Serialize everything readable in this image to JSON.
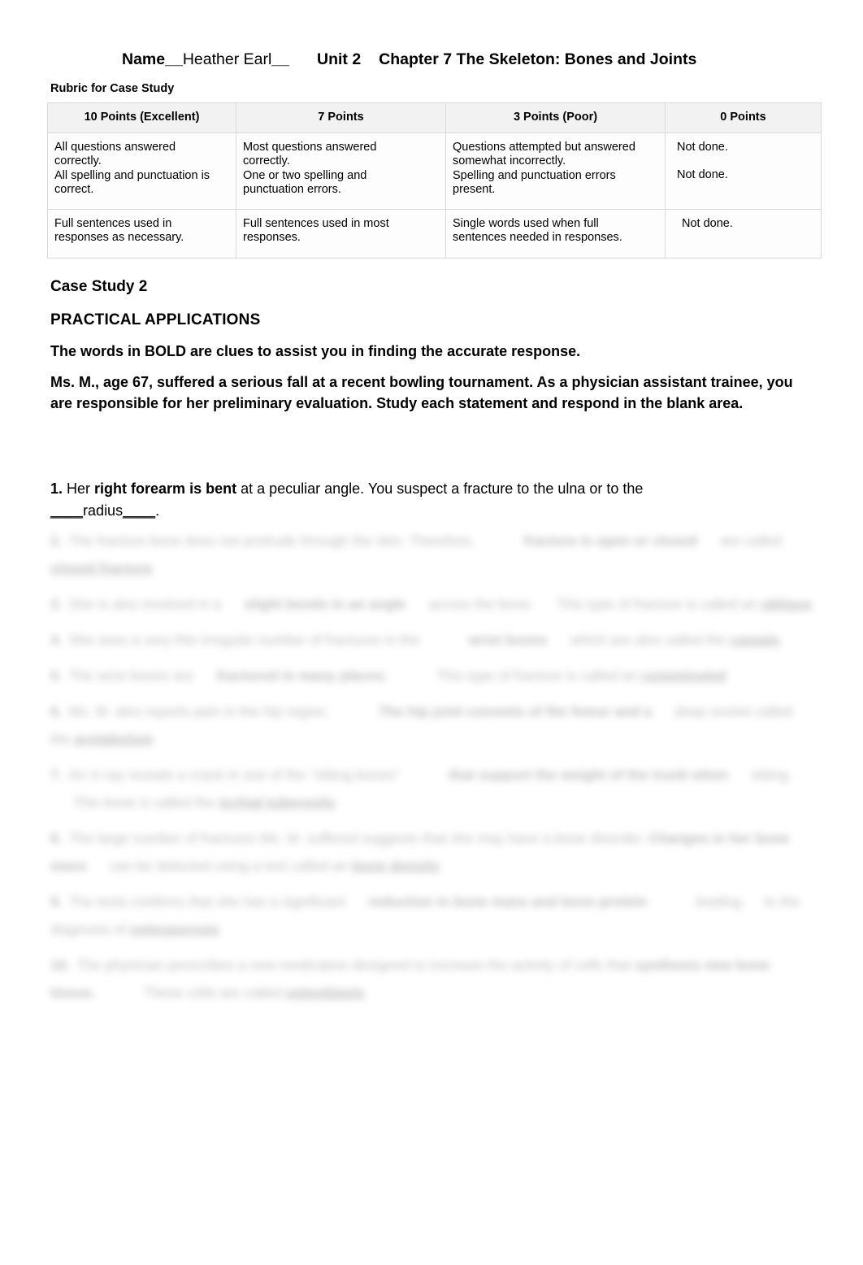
{
  "header": {
    "name_label": "Name",
    "name_underscore_left": "__",
    "name_value": "Heather Earl",
    "name_underscore_right": "__",
    "unit": "Unit 2",
    "chapter": "Chapter 7 The Skeleton: Bones and Joints"
  },
  "rubric": {
    "caption": "Rubric for Case Study",
    "columns": [
      "10 Points (Excellent)",
      "7 Points",
      "3 Points (Poor)",
      "0 Points"
    ],
    "rows": [
      {
        "cells": [
          {
            "lines": [
              "All questions answered",
              "correctly.",
              "All spelling and punctuation is",
              "correct."
            ]
          },
          {
            "lines": [
              "Most questions answered",
              "correctly.",
              "One or two spelling and",
              "punctuation errors."
            ]
          },
          {
            "lines": [
              "Questions attempted but answered",
              "somewhat incorrectly.",
              "Spelling and punctuation errors",
              "present."
            ]
          },
          {
            "lines": [
              "Not done.",
              "",
              "Not done.",
              ""
            ]
          }
        ]
      },
      {
        "cells": [
          {
            "lines": [
              "Full sentences used in",
              "responses as necessary."
            ]
          },
          {
            "lines": [
              "Full sentences used in most",
              "responses."
            ]
          },
          {
            "lines": [
              "Single words used when full",
              "sentences needed in responses."
            ]
          },
          {
            "lines": [
              "Not done."
            ]
          }
        ]
      }
    ]
  },
  "body": {
    "case_study_heading": "Case Study 2",
    "practical_applications_heading": "PRACTICAL APPLICATIONS",
    "bold_clue_note": "The words in BOLD are clues to assist you in finding the accurate response.",
    "scenario": "Ms. M., age 67, suffered a serious fall at a recent bowling tournament.  As a physician assistant trainee, you are responsible for her preliminary evaluation.  Study each statement and respond in the blank area."
  },
  "question_1": {
    "number": "1.",
    "text_before_clue": "Her ",
    "clue": "right forearm is bent",
    "text_after_clue": " at a peculiar angle.  You suspect a fracture to the ulna or to the",
    "blank_prefix": "____",
    "answer": "radius",
    "blank_suffix": "____",
    "trailing": "."
  },
  "redacted_questions": {
    "note": "Questions 2 through 10 are visually blurred and illegible in the source image.",
    "items": [
      {
        "number": "2.",
        "line1": "The fracture bone does not protrude through the skin. Therefore,",
        "line2": "fracture is open or closed",
        "line3": "are called",
        "answer": "closed fracture"
      },
      {
        "number": "3.",
        "line1": "She is also involved in a",
        "line2": "slight bends in an angle",
        "line3": "across the bone.",
        "line4": "This type of fracture is called an",
        "answer": "oblique"
      },
      {
        "number": "4.",
        "line1": "She sees a very thin irregular number of fractures in the",
        "line2": "wrist bones",
        "line3": "which are also called the",
        "answer": "carpals"
      },
      {
        "number": "5.",
        "line1": "The wrist bones are",
        "line2": "fractured in many places.",
        "line3": "This type of fracture is called an",
        "answer": "comminuted"
      },
      {
        "number": "6.",
        "line1": "Ms. M. also reports pain in the hip region.",
        "line2": "The hip joint consists of the femur and a",
        "line3": "deep socket called the",
        "answer": "acetabulum"
      },
      {
        "number": "7.",
        "line1": "An X-ray reveals a crack in one of the \"sitting bones\"",
        "line2": "that support the weight of the trunk when",
        "line3": "sitting.",
        "line4": "This bone is called the",
        "answer": "ischial tuberosity"
      },
      {
        "number": "8.",
        "line1": "The large number of fractures Ms. M. suffered suggests that she may have a bone disorder.",
        "line2": "Changes in her bone mass",
        "line3": "can be detected using a test called an",
        "answer": "bone density"
      },
      {
        "number": "9.",
        "line1": "The tests confirms that she has a significant",
        "line2": "reduction in bone mass and bone protein",
        "line3": "leading",
        "line4": "to the diagnosis of",
        "answer": "osteoporosis"
      },
      {
        "number": "10.",
        "line1": "The physician prescribes a new medication designed to increase the activity of cells that",
        "line2": "synthesis new bone tissue.",
        "line3": "These cells are called",
        "answer": "osteoblasts"
      }
    ]
  }
}
